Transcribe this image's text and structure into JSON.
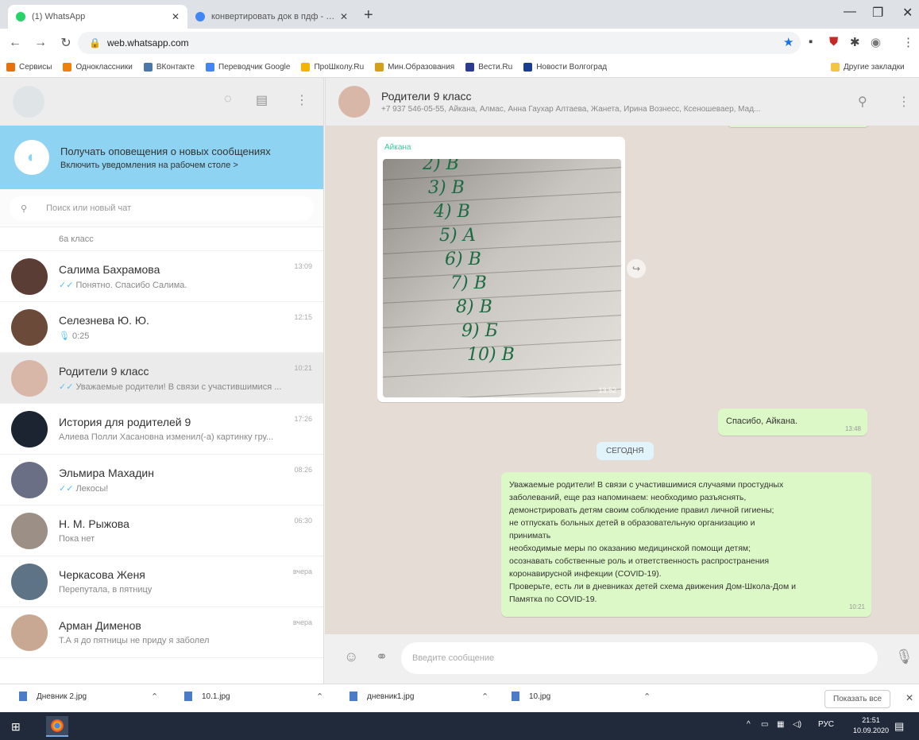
{
  "browser": {
    "tabs": [
      {
        "title": "(1) WhatsApp",
        "favicon_color": "#25d366",
        "active": true
      },
      {
        "title": "конвертировать док в пдф - П...",
        "favicon_color": "#4285f4",
        "active": false
      }
    ],
    "address": "web.whatsapp.com",
    "bookmarks": [
      {
        "label": "Сервисы",
        "color": "#e8710a"
      },
      {
        "label": "Одноклассники",
        "color": "#ee8208"
      },
      {
        "label": "ВКонтакте",
        "color": "#4a76a8"
      },
      {
        "label": "Переводчик Google",
        "color": "#4285f4"
      },
      {
        "label": "ПроШколу.Ru",
        "color": "#f4b400"
      },
      {
        "label": "Мин.Образования",
        "color": "#d4a017"
      },
      {
        "label": "Вести.Ru",
        "color": "#2b3a8f"
      },
      {
        "label": "Новости Волгоград",
        "color": "#1a3d8f"
      }
    ],
    "other_bookmarks": "Другие закладки"
  },
  "sidebar": {
    "notification": {
      "title": "Получать оповещения о новых сообщениях",
      "subtitle": "Включить уведомления на рабочем столе >"
    },
    "search_placeholder": "Поиск или новый чат",
    "partial_preview": "6а класс",
    "chats": [
      {
        "name": "Салима Бахрамова",
        "preview": "Понятно. Спасибо Салима.",
        "time": "13:09",
        "ticks": true,
        "avatar": "#5a3e36"
      },
      {
        "name": "Селезнева Ю. Ю.",
        "preview": "0:25",
        "time": "12:15",
        "mic": true,
        "avatar": "#6b4a3a"
      },
      {
        "name": "Родители 9 класс",
        "preview": "Уважаемые родители! В связи с участившимися ...",
        "time": "10:21",
        "ticks": true,
        "avatar": "#d9b7a8",
        "selected": true
      },
      {
        "name": "История для родителей 9",
        "preview": "Алиева Полли Хасановна изменил(-а) картинку гру...",
        "time": "17:26",
        "avatar": "#1c2431"
      },
      {
        "name": "Эльмира Махадин",
        "preview": "Лекосы!",
        "time": "08:26",
        "ticks": true,
        "avatar": "#6a6f86"
      },
      {
        "name": "Н. М. Рыжова",
        "preview": "Пока нет",
        "time": "06:30",
        "avatar": "#9c8f86"
      },
      {
        "name": "Черкасова Женя",
        "preview": "Перепутала, в пятницу",
        "time": "вчера",
        "avatar": "#5e7386"
      },
      {
        "name": "Арман Дименов",
        "preview": "Т.А я до пятницы не приду я заболел",
        "time": "вчера",
        "avatar": "#c8a893"
      }
    ]
  },
  "conversation": {
    "name": "Родители 9 класс",
    "members": "+7 937 546-05-55, Айкана, Алмас, Анна Гаухар Алтаева, Жанета, Ирина Вознесс, Ксеношеваер, Мад...",
    "photo_message": {
      "sender": "Айкана",
      "time": "13:52",
      "answers": [
        "2) В",
        "3) В",
        "4) В",
        "5) А",
        "6) В",
        "7) В",
        "8) В",
        "9) Б",
        "10) В"
      ]
    },
    "reply": {
      "text": "Спасибо, Айкана.",
      "time": "13:48"
    },
    "date_divider": "СЕГОДНЯ",
    "long_message": {
      "lines": [
        "Уважаемые родители! В связи с участившимися случаями простудных",
        "заболеваний, еще раз напоминаем:  необходимо разъяснять,",
        "демонстрировать детям своим  соблюдение правил личной гигиены;",
        "не отпускать больных детей в образовательную организацию и",
        "принимать",
        "необходимые меры по оказанию медицинской помощи детям;",
        "осознавать собственные роль и ответственность распространения",
        "коронавирусной инфекции (COVID-19).",
        "Проверьте, есть ли в дневниках детей схема движения Дом-Школа-Дом и",
        "Памятка по COVID-19."
      ],
      "time": "10:21"
    },
    "compose_placeholder": "Введите сообщение"
  },
  "downloads": [
    {
      "name": "Дневник 2.jpg"
    },
    {
      "name": "10.1.jpg"
    },
    {
      "name": "дневник1.jpg"
    },
    {
      "name": "10.jpg"
    }
  ],
  "downloads_show_all": "Показать все",
  "taskbar": {
    "lang": "РУС",
    "time": "21:51",
    "date": "10.09.2020"
  }
}
